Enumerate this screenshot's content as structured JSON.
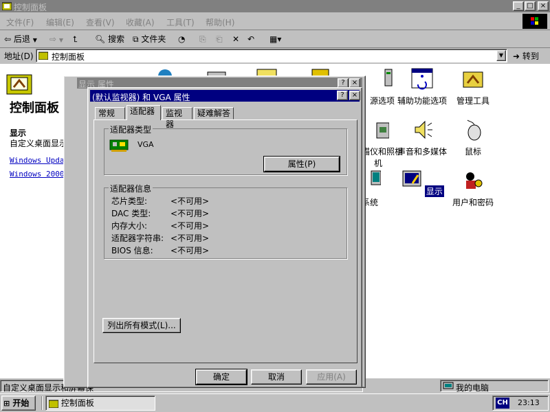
{
  "main_window": {
    "title": "控制面板",
    "caption_buttons": [
      "_",
      "□",
      "×"
    ],
    "menu": [
      "文件(F)",
      "编辑(E)",
      "查看(V)",
      "收藏(A)",
      "工具(T)",
      "帮助(H)"
    ],
    "toolbar": {
      "back": "后退",
      "search": "搜索",
      "folders": "文件夹"
    },
    "address_label": "地址(D)",
    "address_value": "控制面板",
    "go_label": "转到"
  },
  "left_pane": {
    "title": "控制面板",
    "section_heading": "显示",
    "section_desc": "自定义桌面显示和",
    "links": [
      "Windows Update",
      "Windows 2000 支持"
    ]
  },
  "icons": [
    {
      "label": "源选项",
      "icon": "power-icon"
    },
    {
      "label": "辅助功能选项",
      "icon": "accessibility-icon"
    },
    {
      "label": "管理工具",
      "icon": "admin-tools-icon"
    },
    {
      "label": "扫描仪和照相机",
      "icon": "scanner-icon"
    },
    {
      "label": "声音和多媒体",
      "icon": "speaker-icon"
    },
    {
      "label": "鼠标",
      "icon": "mouse-icon"
    },
    {
      "label": "系统",
      "icon": "system-icon"
    },
    {
      "label": "显示",
      "icon": "display-icon"
    },
    {
      "label": "用户和密码",
      "icon": "users-icon"
    }
  ],
  "bg_dialog": {
    "title": "显示 属性"
  },
  "dialog": {
    "title": "(默认监视器) 和 VGA 属性",
    "tabs": [
      "常规",
      "适配器",
      "监视器",
      "疑难解答"
    ],
    "active_tab": "适配器",
    "adapter_type_group": "适配器类型",
    "adapter_name": "VGA",
    "properties_button": "属性(P)",
    "adapter_info_group": "适配器信息",
    "info": [
      {
        "label": "芯片类型:",
        "value": "<不可用>"
      },
      {
        "label": "DAC 类型:",
        "value": "<不可用>"
      },
      {
        "label": "内存大小:",
        "value": "<不可用>"
      },
      {
        "label": "适配器字符串:",
        "value": "<不可用>"
      },
      {
        "label": "BIOS 信息:",
        "value": "<不可用>"
      }
    ],
    "list_modes_button": "列出所有模式(L)...",
    "ok": "确定",
    "cancel": "取消",
    "apply": "应用(A)"
  },
  "statusbar": {
    "left_text": "自定义桌面显示和屏幕保",
    "right_text": "我的电脑"
  },
  "taskbar": {
    "start": "开始",
    "task": "控制面板",
    "ime": "CH",
    "clock": "23:13"
  }
}
